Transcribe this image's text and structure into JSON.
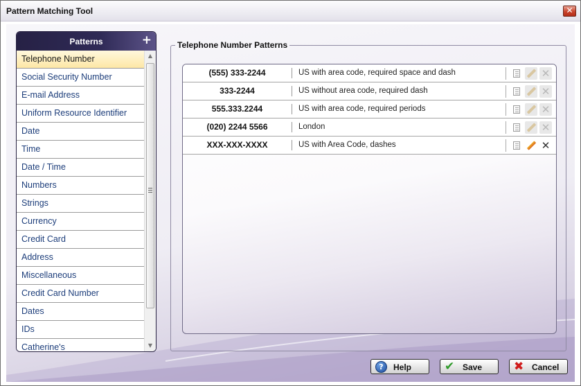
{
  "window": {
    "title": "Pattern Matching Tool",
    "close_glyph": "✕"
  },
  "patterns": {
    "header": "Patterns",
    "add_glyph": "+",
    "items": [
      {
        "label": "Telephone Number",
        "selected": true
      },
      {
        "label": "Social Security Number"
      },
      {
        "label": "E-mail Address"
      },
      {
        "label": "Uniform Resource Identifier"
      },
      {
        "label": "Date"
      },
      {
        "label": "Time"
      },
      {
        "label": "Date / Time"
      },
      {
        "label": "Numbers"
      },
      {
        "label": "Strings"
      },
      {
        "label": "Currency"
      },
      {
        "label": "Credit Card"
      },
      {
        "label": "Address"
      },
      {
        "label": "Miscellaneous"
      },
      {
        "label": "Credit Card Number"
      },
      {
        "label": "Dates"
      },
      {
        "label": "IDs"
      },
      {
        "label": "Catherine's"
      }
    ]
  },
  "group": {
    "title": "Telephone Number Patterns",
    "rows": [
      {
        "pattern": "(555) 333-2244",
        "description": "US with area code, required space and dash",
        "editable": false
      },
      {
        "pattern": "333-2244",
        "description": "US without area code, required dash",
        "editable": false
      },
      {
        "pattern": "555.333.2244",
        "description": "US with area code, required periods",
        "editable": false
      },
      {
        "pattern": "(020) 2244 5566",
        "description": "London",
        "editable": false
      },
      {
        "pattern": "XXX-XXX-XXXX",
        "description": "US with Area Code, dashes",
        "editable": true
      }
    ]
  },
  "buttons": {
    "help": "Help",
    "save": "Save",
    "cancel": "Cancel"
  },
  "icons": {
    "help": "help-icon",
    "save": "checkmark-icon",
    "cancel": "cancel-x-icon",
    "copy": "copy-icon",
    "edit": "pencil-icon",
    "delete": "delete-x-icon"
  },
  "colors": {
    "header_bg": "#262145",
    "selected_bg": "#fde7a5",
    "link_text": "#1c3d7a",
    "accent_purple": "#c1b5d3"
  }
}
